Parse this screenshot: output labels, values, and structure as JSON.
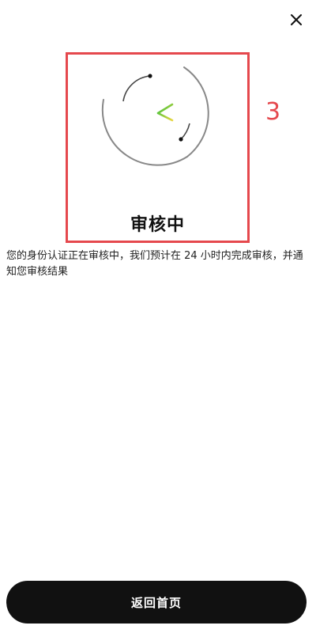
{
  "header": {
    "close_icon": "close-icon"
  },
  "status": {
    "title": "审核中",
    "step_number": "3",
    "description": "您的身份认证正在审核中，我们预计在 24 小时内完成审核，并通知您审核结果",
    "spinner_icon": "loading-spinner-icon",
    "accent_color": "#3cc63c",
    "highlight_color": "#e5484d"
  },
  "footer": {
    "home_button_label": "返回首页"
  }
}
